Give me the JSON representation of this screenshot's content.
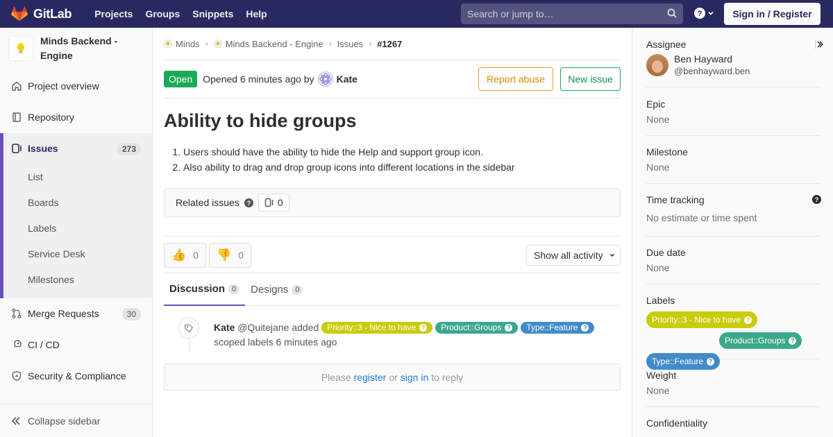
{
  "nav": {
    "brand": "GitLab",
    "menu": [
      "Projects",
      "Groups",
      "Snippets",
      "Help"
    ],
    "search_placeholder": "Search or jump to…",
    "signin": "Sign in / Register"
  },
  "sidebar": {
    "project_name": "Minds Backend - Engine",
    "overview": "Project overview",
    "repository": "Repository",
    "issues": {
      "label": "Issues",
      "count": "273",
      "sub": [
        "List",
        "Boards",
        "Labels",
        "Service Desk",
        "Milestones"
      ]
    },
    "merge_requests": {
      "label": "Merge Requests",
      "count": "30"
    },
    "cicd": "CI / CD",
    "security": "Security & Compliance",
    "collapse": "Collapse sidebar"
  },
  "breadcrumb": [
    "Minds",
    "Minds Backend - Engine",
    "Issues",
    "#1267"
  ],
  "issue": {
    "status": "Open",
    "opened_text": "Opened 6 minutes ago by",
    "author": "Kate",
    "report_abuse": "Report abuse",
    "new_issue": "New issue",
    "title": "Ability to hide groups",
    "description": [
      "Users should have the ability to hide the Help and support group icon.",
      "Also ability to drag and drop group icons into different locations in the sidebar"
    ],
    "related_label": "Related issues",
    "related_count": "0",
    "thumbs_up": "0",
    "thumbs_down": "0",
    "show_activity": "Show all activity",
    "tabs": [
      {
        "label": "Discussion",
        "count": "0"
      },
      {
        "label": "Designs",
        "count": "0"
      }
    ],
    "note": {
      "author": "Kate",
      "handle": "@Quitejane",
      "action": "added",
      "suffix": "scoped labels 6 minutes ago"
    },
    "reply": {
      "pre": "Please",
      "register": "register",
      "or": "or",
      "signin": "sign in",
      "post": "to reply"
    }
  },
  "labels": [
    {
      "text": "Priority::3 - Nice to have",
      "color": "#c9cc0c"
    },
    {
      "text": "Product::Groups",
      "color": "#3ba88e"
    },
    {
      "text": "Type::Feature",
      "color": "#428bca"
    }
  ],
  "right_sidebar": {
    "assignee_title": "Assignee",
    "assignee_name": "Ben Hayward",
    "assignee_handle": "@benhayward.ben",
    "epic_title": "Epic",
    "epic_value": "None",
    "milestone_title": "Milestone",
    "milestone_value": "None",
    "time_title": "Time tracking",
    "time_value": "No estimate or time spent",
    "due_title": "Due date",
    "due_value": "None",
    "labels_title": "Labels",
    "weight_title": "Weight",
    "weight_value": "None",
    "confidentiality_title": "Confidentiality"
  }
}
